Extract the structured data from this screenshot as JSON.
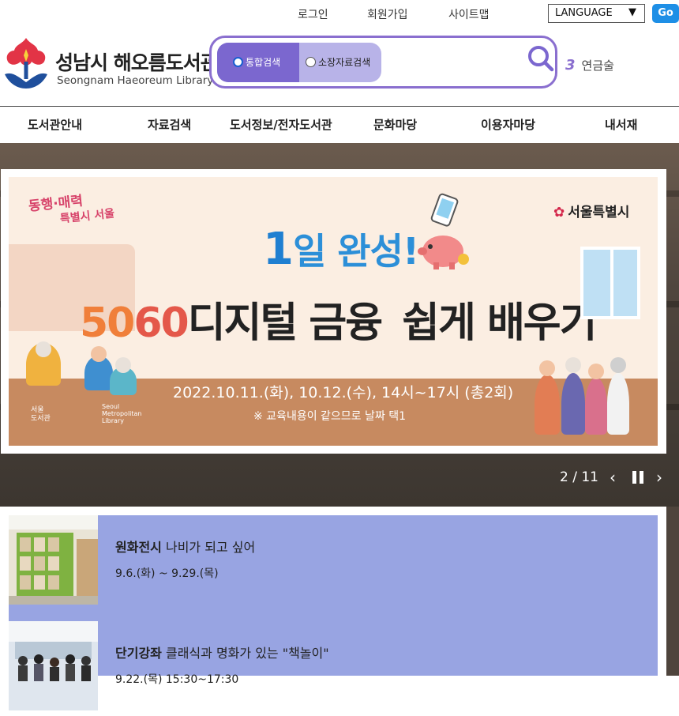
{
  "topbar": {
    "login": "로그인",
    "join": "회원가입",
    "sitemap": "사이트맵",
    "language": "LANGUAGE",
    "go": "Go"
  },
  "logo": {
    "title": "성남시 해오름도서관",
    "subtitle": "Seongnam Haeoreum Library"
  },
  "search": {
    "tab_all": "통합검색",
    "tab_holdings": "소장자료검색",
    "selected": "통합검색"
  },
  "trending": {
    "rank": "3",
    "keyword": "연금술"
  },
  "gnb": [
    "도서관안내",
    "자료검색",
    "도서정보/전자도서관",
    "문화마당",
    "이용자마당",
    "내서재"
  ],
  "banner": {
    "slogan_line1": "동행·매력",
    "slogan_line2": "특별시 서울",
    "city": "서울특별시",
    "headline_num": "1",
    "headline_text": "일 완성!",
    "title_num1": "50",
    "title_num2": "60",
    "title_text1": "디지털 금융",
    "title_text2": "쉽게 배우기",
    "date": "2022.10.11.(화), 10.12.(수), 14시~17시 (총2회)",
    "note": "※ 교육내용이 같으므로 날짜 택1",
    "lib_logo": "서울\n도서관",
    "lib_logo_en": "Seoul\nMetropolitan\nLibrary"
  },
  "slider": {
    "current": "2",
    "total": "11",
    "display": "2 / 11"
  },
  "events": [
    {
      "category": "원화전시",
      "title": "나비가 되고 싶어",
      "date": "9.6.(화) ~ 9.29.(목)"
    },
    {
      "category": "단기강좌",
      "title": "클래식과 명화가 있는 \"책놀이\"",
      "date": "9.22.(목) 15:30~17:30"
    }
  ],
  "colors": {
    "accent_purple": "#7b67cf",
    "search_border": "#8a6fcf",
    "go_blue": "#1e8fe6",
    "event_bg": "#98a4e2"
  }
}
